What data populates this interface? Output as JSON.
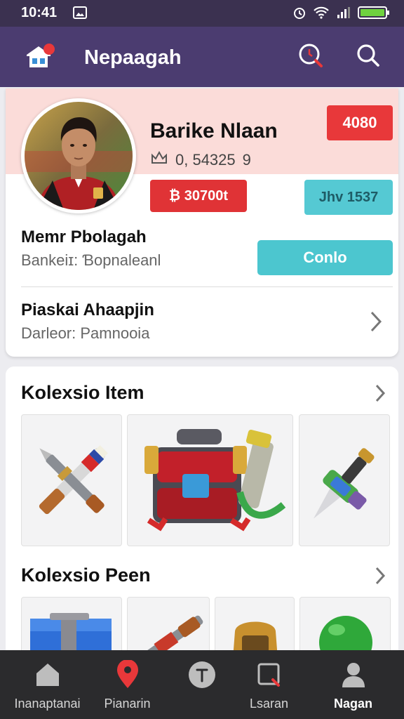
{
  "status_bar": {
    "time": "10:41",
    "icons": [
      "image-icon",
      "alarm-icon",
      "wifi-icon",
      "signal-icon",
      "battery-icon"
    ]
  },
  "app_bar": {
    "title": "Nepaagah",
    "logo": "app-logo-icon",
    "actions": [
      "search-alt-icon",
      "search-icon"
    ]
  },
  "profile": {
    "name": "Barike Nlaan",
    "stat_text": "0, 54325",
    "stat_suffix": "9",
    "score_badge": "4080",
    "coins": "₿ ‌30700t",
    "date_badge": "Jhv 1537",
    "member_title": "Memr Pbolagah",
    "member_sub": "Bankeiɪ: Ɓopnaleanl",
    "button_label": "Conlo",
    "second_title": "Piaskai Ahaapjin",
    "second_sub": "Darleor: Pamnooia"
  },
  "sections": {
    "items_title": "Kolexsio Item",
    "pets_title": "Kolexsio Peen"
  },
  "bottom_nav": {
    "items": [
      {
        "label": "Inanaptanai",
        "icon": "home-icon"
      },
      {
        "label": "Pianarin",
        "icon": "location-pin-icon"
      },
      {
        "label": "",
        "icon": "compass-icon"
      },
      {
        "label": "Lsaran",
        "icon": "store-icon"
      },
      {
        "label": "Nagan",
        "icon": "profile-icon"
      }
    ]
  },
  "colors": {
    "app_bar": "#4b3c70",
    "status_bar": "#3b3150",
    "accent_red": "#e03336",
    "accent_teal": "#4cc6cf",
    "nav_active": "#e8383a"
  }
}
